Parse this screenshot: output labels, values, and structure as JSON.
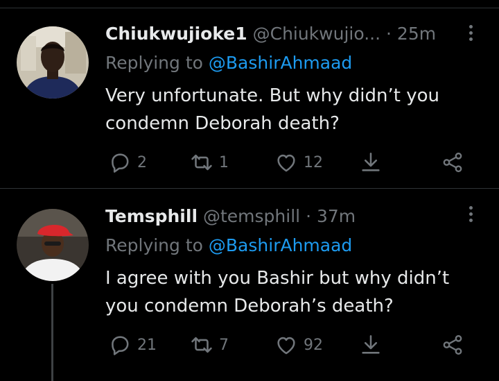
{
  "tweets": [
    {
      "display_name": "Chiukwujioke1",
      "handle": "@Chiukwujio...",
      "separator": "·",
      "time": "25m",
      "replying_prefix": "Replying to",
      "replying_to": "@BashirAhmaad",
      "text": "Very unfortunate. But why didn’t you condemn Deborah death?",
      "replies": "2",
      "retweets": "1",
      "likes": "12"
    },
    {
      "display_name": "Temsphill",
      "handle": "@temsphill",
      "separator": "·",
      "time": "37m",
      "replying_prefix": "Replying to",
      "replying_to": "@BashirAhmaad",
      "text": "I agree with you Bashir but why didn’t you condemn Deborah’s death?",
      "replies": "21",
      "retweets": "7",
      "likes": "92"
    }
  ],
  "icons": {
    "reply": "reply-icon",
    "retweet": "retweet-icon",
    "like": "heart-icon",
    "download": "download-icon",
    "share": "share-icon",
    "more": "more-vertical-icon"
  },
  "colors": {
    "background": "#000000",
    "text": "#e7e9ea",
    "muted": "#71767b",
    "link": "#1d9bf0",
    "divider": "#2f3336"
  }
}
